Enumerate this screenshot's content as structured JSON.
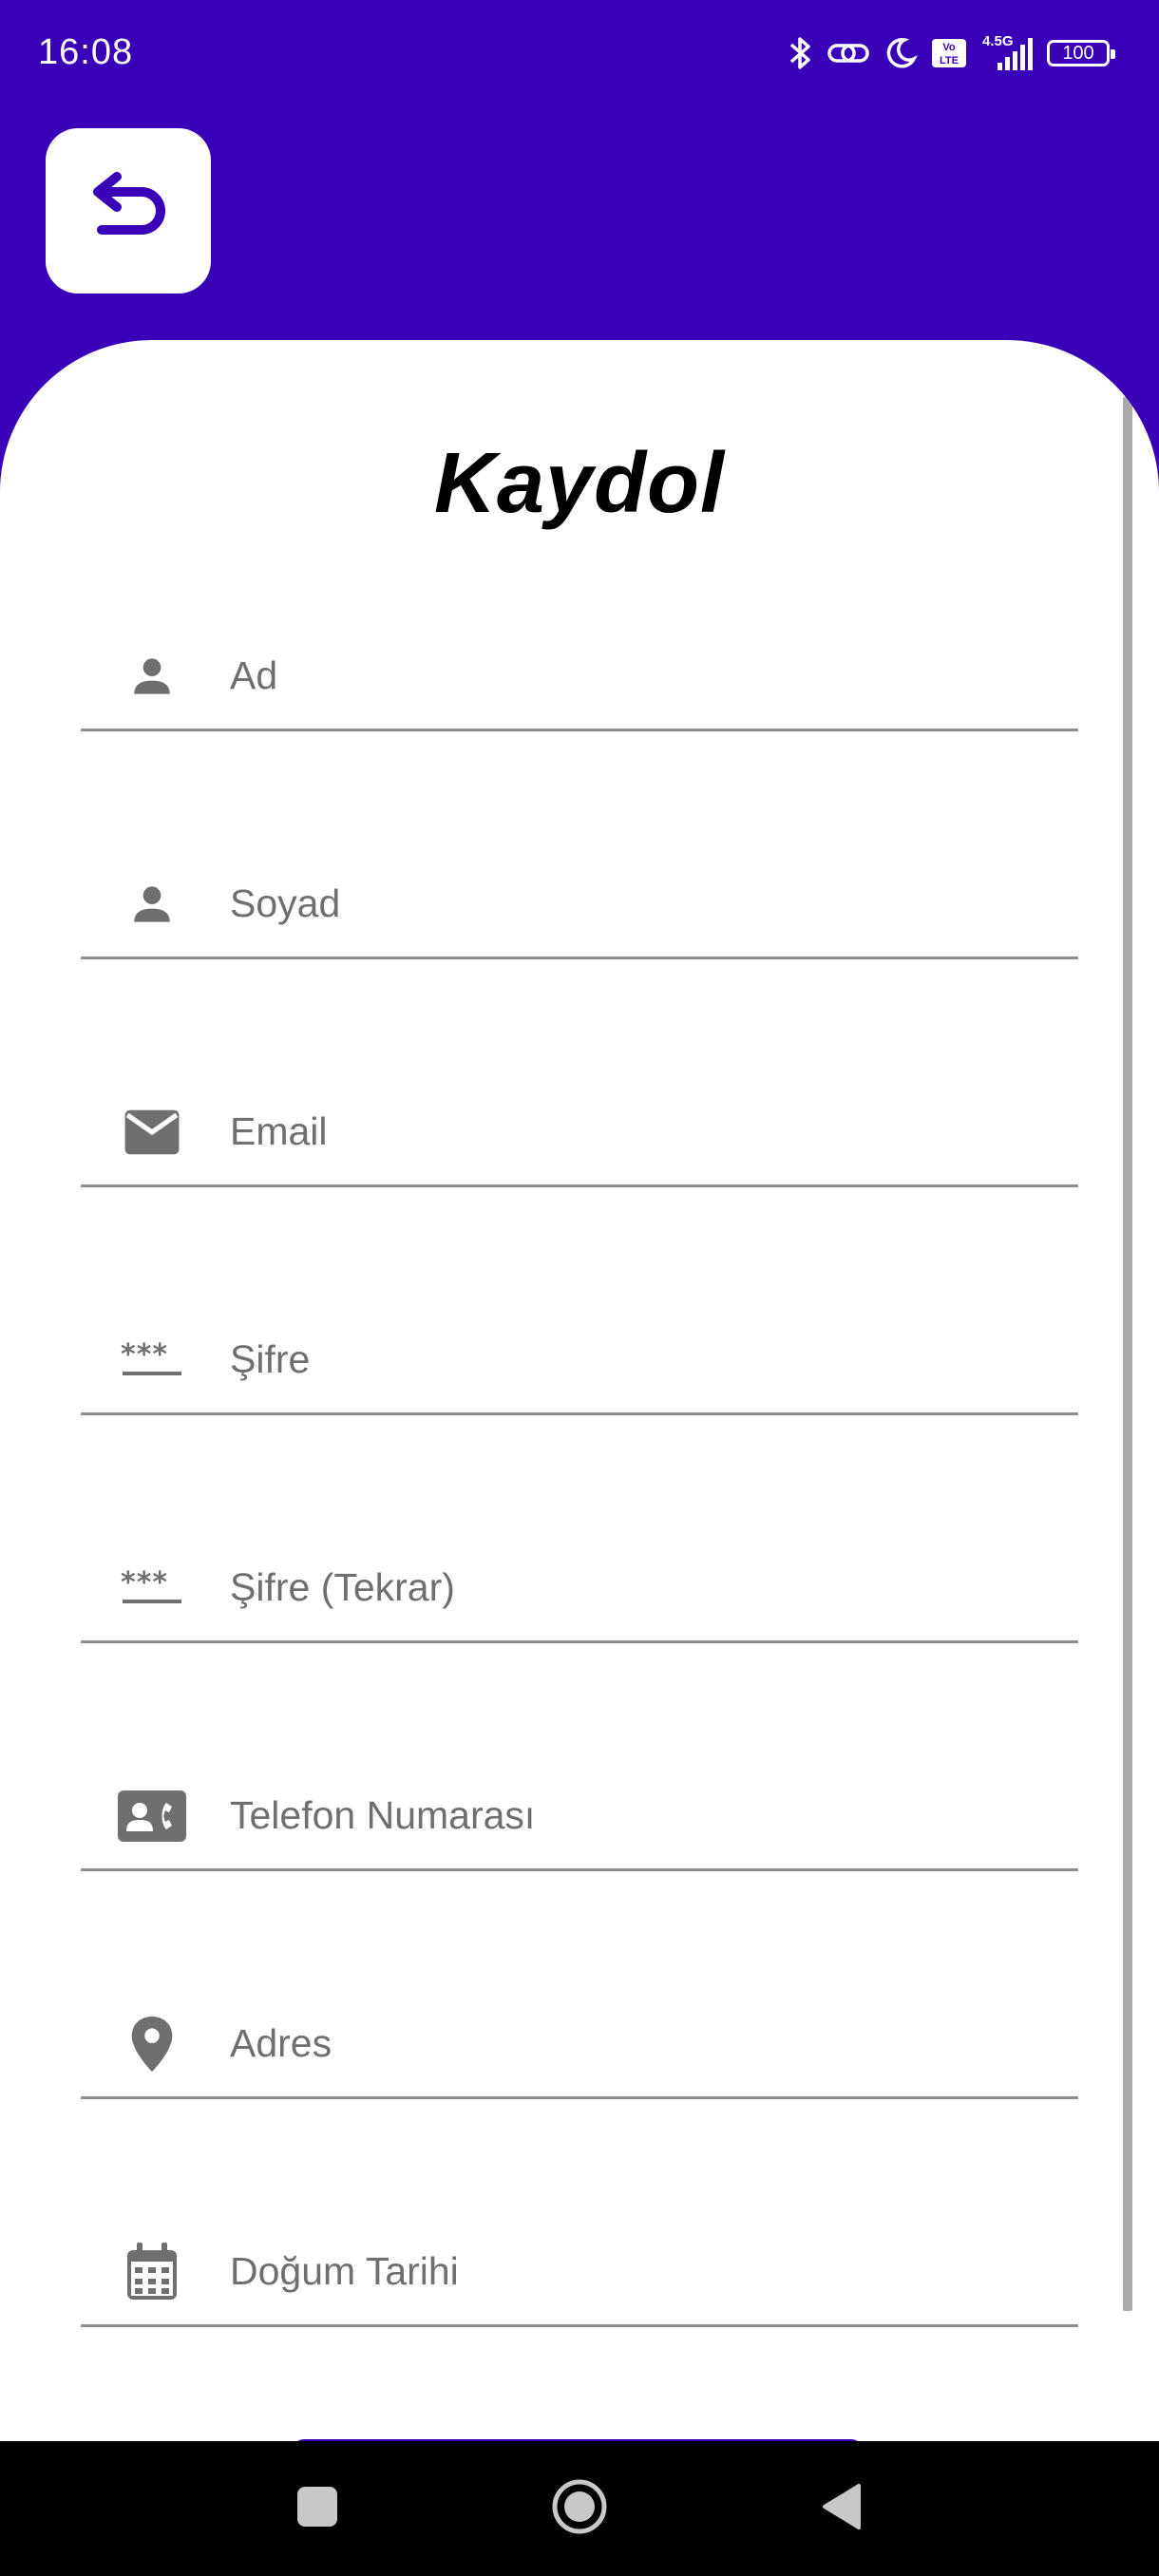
{
  "status_bar": {
    "time": "16:08",
    "network": "4.5G",
    "volte": "Vo LTE",
    "battery": "100"
  },
  "header": {
    "back_icon": "undo-arrow-icon"
  },
  "form": {
    "title": "Kaydol",
    "fields": [
      {
        "label": "Ad",
        "icon": "person-icon"
      },
      {
        "label": "Soyad",
        "icon": "person-icon"
      },
      {
        "label": "Email",
        "icon": "email-icon"
      },
      {
        "label": "Şifre",
        "icon": "password-icon"
      },
      {
        "label": "Şifre (Tekrar)",
        "icon": "password-icon"
      },
      {
        "label": "Telefon Numarası",
        "icon": "contact-phone-icon"
      },
      {
        "label": "Adres",
        "icon": "location-pin-icon"
      },
      {
        "label": "Doğum Tarihi",
        "icon": "calendar-icon"
      }
    ]
  },
  "colors": {
    "primary": "#3a00b8",
    "card": "#ffffff",
    "label": "#6f6f6f",
    "nav_bar": "#000000"
  }
}
